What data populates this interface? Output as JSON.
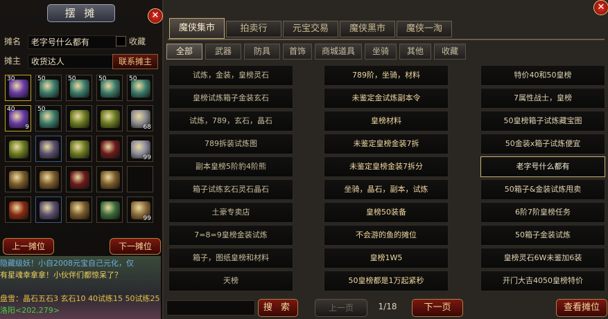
{
  "stall": {
    "title": "摆 摊",
    "name_label": "摊名",
    "name_value": "老字号什么都有",
    "collect_label": "收藏",
    "owner_label": "摊主",
    "owner_value": "收货达人",
    "contact_label": "联系摊主",
    "prev_label": "上一摊位",
    "next_label": "下一摊位",
    "inventory": [
      {
        "icon": "purple-book-icon",
        "count": "30",
        "color": "#6a3aa8"
      },
      {
        "icon": "treasure-chest-icon",
        "count": "50",
        "color": "#3a7a6a"
      },
      {
        "icon": "treasure-chest-icon",
        "count": "50",
        "color": "#3a7a6a"
      },
      {
        "icon": "treasure-chest-icon",
        "count": "50",
        "color": "#3a7a6a"
      },
      {
        "icon": "treasure-chest-icon",
        "count": "50",
        "color": "#3a7a6a"
      },
      {
        "icon": "purple-book-icon",
        "count": "40",
        "count2": "9",
        "color": "#6a3aa8"
      },
      {
        "icon": "treasure-chest-icon",
        "count": "50",
        "color": "#3a7a6a"
      },
      {
        "icon": "gold-armor-icon",
        "count": "",
        "color": "#6a7a20"
      },
      {
        "icon": "gold-armor-icon",
        "count": "",
        "color": "#6a7a20"
      },
      {
        "icon": "fan-icon",
        "count": "",
        "count2": "68",
        "color": "#8a8a90"
      },
      {
        "icon": "gold-armor-icon",
        "count": "",
        "color": "#6a7a20"
      },
      {
        "icon": "silver-helmet-icon",
        "count": "",
        "color": "#5a5070"
      },
      {
        "icon": "gold-armor-icon",
        "count": "",
        "color": "#6a7a20"
      },
      {
        "icon": "red-blade-icon",
        "count": "",
        "color": "#6a1a1a"
      },
      {
        "icon": "wing-icon",
        "count": "",
        "count2": "99",
        "color": "#8a8a9a"
      },
      {
        "icon": "bronze-helmet-icon",
        "count": "",
        "color": "#7a5a2a"
      },
      {
        "icon": "bronze-helmet-icon",
        "count": "",
        "color": "#7a5a2a"
      },
      {
        "icon": "red-blade-icon",
        "count": "",
        "color": "#6a1a1a"
      },
      {
        "icon": "bronze-helmet-icon",
        "count": "",
        "color": "#7a5a2a"
      },
      {
        "icon": "empty-slot",
        "count": "",
        "color": ""
      },
      {
        "icon": "red-sword-icon",
        "count": "",
        "color": "#8a2a10"
      },
      {
        "icon": "silver-helmet-icon",
        "count": "",
        "color": "#5a5070"
      },
      {
        "icon": "bronze-helmet-icon",
        "count": "",
        "color": "#7a5a2a"
      },
      {
        "icon": "green-boots-icon",
        "count": "",
        "color": "#3a6a3a"
      },
      {
        "icon": "rope-icon",
        "count": "",
        "count2": "99",
        "color": "#8a6a3a"
      }
    ]
  },
  "chat": [
    {
      "text": "隐藏级妖！小自2008元宝自己元化，仅",
      "color": "#6ab0e0"
    },
    {
      "text": "有星魂幸拿拿！小伙伴们都惊呆了？",
      "color": "#f0d060"
    },
    {
      "text": "",
      "color": "#c8c8c8"
    },
    {
      "text": "盘雪：晶石五石3 玄石10 40试练15 50试练25",
      "color": "#e0c040"
    },
    {
      "text": "洛阳<202,279>",
      "color": "#40d040"
    }
  ],
  "market": {
    "main_tabs": [
      "魔侠集市",
      "拍卖行",
      "元宝交易",
      "魔侠黑市",
      "魔侠一淘"
    ],
    "sub_tabs": [
      "全部",
      "武器",
      "防具",
      "首饰",
      "商城道具",
      "坐骑",
      "其他",
      "收藏"
    ],
    "stalls": [
      [
        "试炼，金装，皇榜灵石",
        "789阶，坐骑，材料",
        "特价40和50皇榜"
      ],
      [
        "皇榜试炼箱子金装玄石",
        "未鉴定金试炼副本令",
        "7属性战士，皇榜"
      ],
      [
        "试炼，789，玄石，晶石",
        "皇榜材料",
        "50皇榜箱子试炼藏宝图"
      ],
      [
        "789拆装试炼图",
        "未鉴定皇榜金装7拆",
        "50金装x箱子试炼便宜"
      ],
      [
        "副本皇榜5阶豹4阶熊",
        "未鉴定皇榜金装7拆分",
        "老字号什么都有"
      ],
      [
        "箱子试练玄石灵石晶石",
        "坐骑，晶石，副本，试炼",
        "50箱子&金装试炼甩卖"
      ],
      [
        "土豪专卖店",
        "皇榜50装备",
        "6阶7阶皇榜任务"
      ],
      [
        "7=8=9皇榜金装试炼",
        "不会游的鱼的摊位",
        "50箱子金装试炼"
      ],
      [
        "箱子，图纸皇榜和材料",
        "皇榜1W5",
        "皇榜灵石6W未鉴加6装"
      ],
      [
        "天榜",
        "50皇榜都是1万起紧秒",
        "开门大吉4050皇榜特价"
      ]
    ],
    "search_label": "搜 索",
    "prev_page": "上一页",
    "page_indicator": "1/18",
    "next_page": "下一页",
    "view_stall": "查看摊位"
  }
}
